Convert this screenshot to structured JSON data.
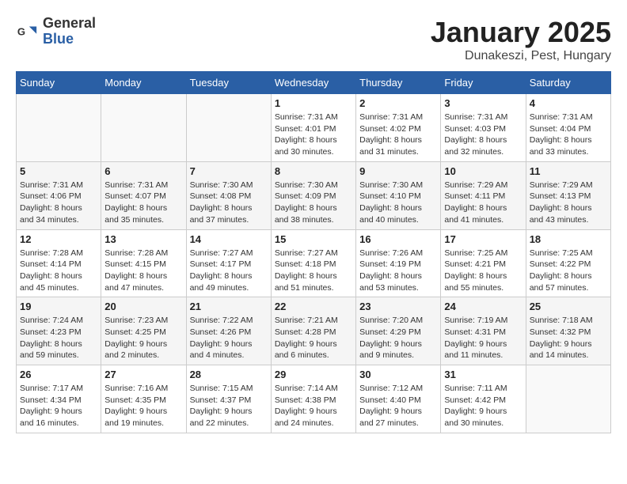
{
  "header": {
    "logo_line1": "General",
    "logo_line2": "Blue",
    "month_title": "January 2025",
    "location": "Dunakeszi, Pest, Hungary"
  },
  "weekdays": [
    "Sunday",
    "Monday",
    "Tuesday",
    "Wednesday",
    "Thursday",
    "Friday",
    "Saturday"
  ],
  "weeks": [
    [
      {
        "day": "",
        "info": ""
      },
      {
        "day": "",
        "info": ""
      },
      {
        "day": "",
        "info": ""
      },
      {
        "day": "1",
        "info": "Sunrise: 7:31 AM\nSunset: 4:01 PM\nDaylight: 8 hours\nand 30 minutes."
      },
      {
        "day": "2",
        "info": "Sunrise: 7:31 AM\nSunset: 4:02 PM\nDaylight: 8 hours\nand 31 minutes."
      },
      {
        "day": "3",
        "info": "Sunrise: 7:31 AM\nSunset: 4:03 PM\nDaylight: 8 hours\nand 32 minutes."
      },
      {
        "day": "4",
        "info": "Sunrise: 7:31 AM\nSunset: 4:04 PM\nDaylight: 8 hours\nand 33 minutes."
      }
    ],
    [
      {
        "day": "5",
        "info": "Sunrise: 7:31 AM\nSunset: 4:06 PM\nDaylight: 8 hours\nand 34 minutes."
      },
      {
        "day": "6",
        "info": "Sunrise: 7:31 AM\nSunset: 4:07 PM\nDaylight: 8 hours\nand 35 minutes."
      },
      {
        "day": "7",
        "info": "Sunrise: 7:30 AM\nSunset: 4:08 PM\nDaylight: 8 hours\nand 37 minutes."
      },
      {
        "day": "8",
        "info": "Sunrise: 7:30 AM\nSunset: 4:09 PM\nDaylight: 8 hours\nand 38 minutes."
      },
      {
        "day": "9",
        "info": "Sunrise: 7:30 AM\nSunset: 4:10 PM\nDaylight: 8 hours\nand 40 minutes."
      },
      {
        "day": "10",
        "info": "Sunrise: 7:29 AM\nSunset: 4:11 PM\nDaylight: 8 hours\nand 41 minutes."
      },
      {
        "day": "11",
        "info": "Sunrise: 7:29 AM\nSunset: 4:13 PM\nDaylight: 8 hours\nand 43 minutes."
      }
    ],
    [
      {
        "day": "12",
        "info": "Sunrise: 7:28 AM\nSunset: 4:14 PM\nDaylight: 8 hours\nand 45 minutes."
      },
      {
        "day": "13",
        "info": "Sunrise: 7:28 AM\nSunset: 4:15 PM\nDaylight: 8 hours\nand 47 minutes."
      },
      {
        "day": "14",
        "info": "Sunrise: 7:27 AM\nSunset: 4:17 PM\nDaylight: 8 hours\nand 49 minutes."
      },
      {
        "day": "15",
        "info": "Sunrise: 7:27 AM\nSunset: 4:18 PM\nDaylight: 8 hours\nand 51 minutes."
      },
      {
        "day": "16",
        "info": "Sunrise: 7:26 AM\nSunset: 4:19 PM\nDaylight: 8 hours\nand 53 minutes."
      },
      {
        "day": "17",
        "info": "Sunrise: 7:25 AM\nSunset: 4:21 PM\nDaylight: 8 hours\nand 55 minutes."
      },
      {
        "day": "18",
        "info": "Sunrise: 7:25 AM\nSunset: 4:22 PM\nDaylight: 8 hours\nand 57 minutes."
      }
    ],
    [
      {
        "day": "19",
        "info": "Sunrise: 7:24 AM\nSunset: 4:23 PM\nDaylight: 8 hours\nand 59 minutes."
      },
      {
        "day": "20",
        "info": "Sunrise: 7:23 AM\nSunset: 4:25 PM\nDaylight: 9 hours\nand 2 minutes."
      },
      {
        "day": "21",
        "info": "Sunrise: 7:22 AM\nSunset: 4:26 PM\nDaylight: 9 hours\nand 4 minutes."
      },
      {
        "day": "22",
        "info": "Sunrise: 7:21 AM\nSunset: 4:28 PM\nDaylight: 9 hours\nand 6 minutes."
      },
      {
        "day": "23",
        "info": "Sunrise: 7:20 AM\nSunset: 4:29 PM\nDaylight: 9 hours\nand 9 minutes."
      },
      {
        "day": "24",
        "info": "Sunrise: 7:19 AM\nSunset: 4:31 PM\nDaylight: 9 hours\nand 11 minutes."
      },
      {
        "day": "25",
        "info": "Sunrise: 7:18 AM\nSunset: 4:32 PM\nDaylight: 9 hours\nand 14 minutes."
      }
    ],
    [
      {
        "day": "26",
        "info": "Sunrise: 7:17 AM\nSunset: 4:34 PM\nDaylight: 9 hours\nand 16 minutes."
      },
      {
        "day": "27",
        "info": "Sunrise: 7:16 AM\nSunset: 4:35 PM\nDaylight: 9 hours\nand 19 minutes."
      },
      {
        "day": "28",
        "info": "Sunrise: 7:15 AM\nSunset: 4:37 PM\nDaylight: 9 hours\nand 22 minutes."
      },
      {
        "day": "29",
        "info": "Sunrise: 7:14 AM\nSunset: 4:38 PM\nDaylight: 9 hours\nand 24 minutes."
      },
      {
        "day": "30",
        "info": "Sunrise: 7:12 AM\nSunset: 4:40 PM\nDaylight: 9 hours\nand 27 minutes."
      },
      {
        "day": "31",
        "info": "Sunrise: 7:11 AM\nSunset: 4:42 PM\nDaylight: 9 hours\nand 30 minutes."
      },
      {
        "day": "",
        "info": ""
      }
    ]
  ]
}
